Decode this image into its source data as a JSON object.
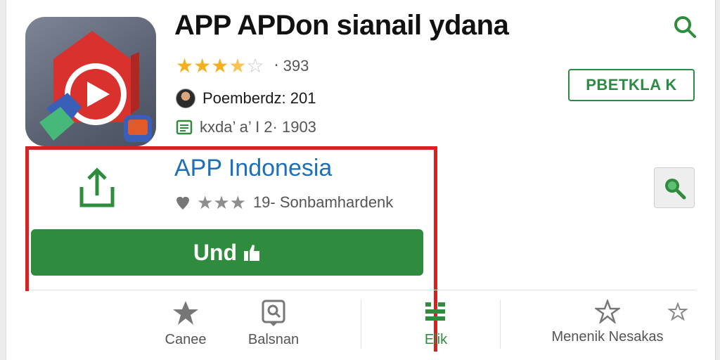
{
  "header": {
    "title": "APP  APDon sianail ydana",
    "rating_text": "‧ 393",
    "developer": "Poemberdz: 201",
    "size_info": "kxda’ a’ I 2· 1903",
    "install_label": "PBETKLA K"
  },
  "listing": {
    "title": "APP Indonesia",
    "meta": "19- Sonbamhardenk",
    "install_label": "Und"
  },
  "nav": {
    "items": [
      {
        "label": "Canee"
      },
      {
        "label": "Balsnan"
      },
      {
        "label": "Elik"
      },
      {
        "label": "Menenik Nesakas"
      }
    ]
  },
  "colors": {
    "accent_green": "#2f8c3f",
    "link_blue": "#1d6fb8",
    "highlight_red": "#d62222",
    "star_gold": "#f2b01e"
  }
}
